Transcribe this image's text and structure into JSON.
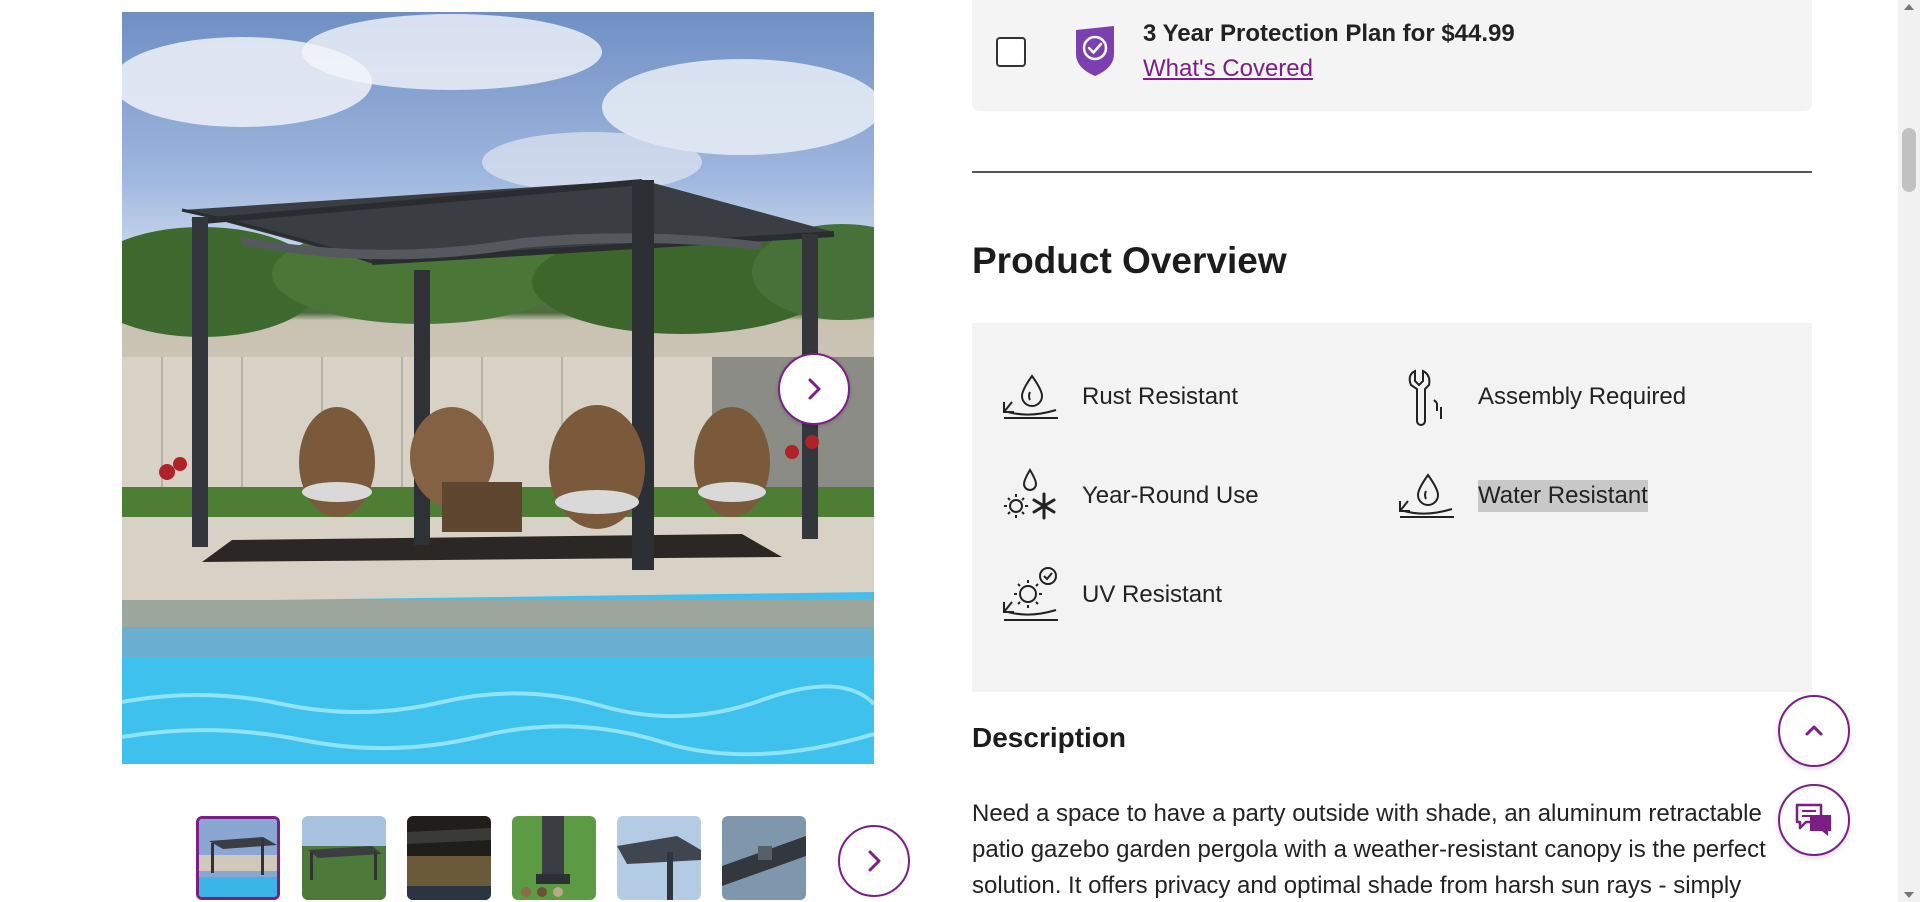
{
  "gallery": {
    "hero_alt": "Aluminum retractable pergola by a pool",
    "next_icon": "chevron-right-icon",
    "thumbnails": [
      {
        "name": "thumbnail-1",
        "colors": [
          "#6f8fc4",
          "#3a3d42",
          "#3cb4e6"
        ]
      },
      {
        "name": "thumbnail-2",
        "colors": [
          "#8fb0d6",
          "#3f6b33",
          "#6d8a4a"
        ]
      },
      {
        "name": "thumbnail-3",
        "colors": [
          "#2a2a26",
          "#6a5a3a",
          "#3a3426"
        ]
      },
      {
        "name": "thumbnail-4",
        "colors": [
          "#5f9a43",
          "#3a3d42",
          "#4c8a36"
        ]
      },
      {
        "name": "thumbnail-5",
        "colors": [
          "#a9c4e0",
          "#3f4650",
          "#6d7b8a"
        ]
      },
      {
        "name": "thumbnail-6",
        "colors": [
          "#7f97ad",
          "#33383e",
          "#56606a"
        ]
      }
    ]
  },
  "protection": {
    "plan_title": "3 Year Protection Plan for $44.99",
    "covered_link": "What's Covered",
    "accent_color": "#7b1f87"
  },
  "overview": {
    "title": "Product Overview",
    "features": [
      {
        "label": "Rust Resistant",
        "icon": "rust-resistant-icon"
      },
      {
        "label": "Assembly Required",
        "icon": "wrench-icon"
      },
      {
        "label": "Year-Round Use",
        "icon": "year-round-icon"
      },
      {
        "label": "Water Resistant",
        "icon": "water-resistant-icon"
      },
      {
        "label": "UV Resistant",
        "icon": "uv-resistant-icon"
      }
    ]
  },
  "description": {
    "title": "Description",
    "text": "Need a space to have a party outside with shade, an aluminum retractable patio gazebo garden pergola with a weather-resistant canopy is the perfect solution. It offers privacy and optimal shade from harsh sun rays - simply"
  },
  "floating": {
    "scroll_top_icon": "chevron-up-icon",
    "chat_icon": "chat-icon"
  }
}
